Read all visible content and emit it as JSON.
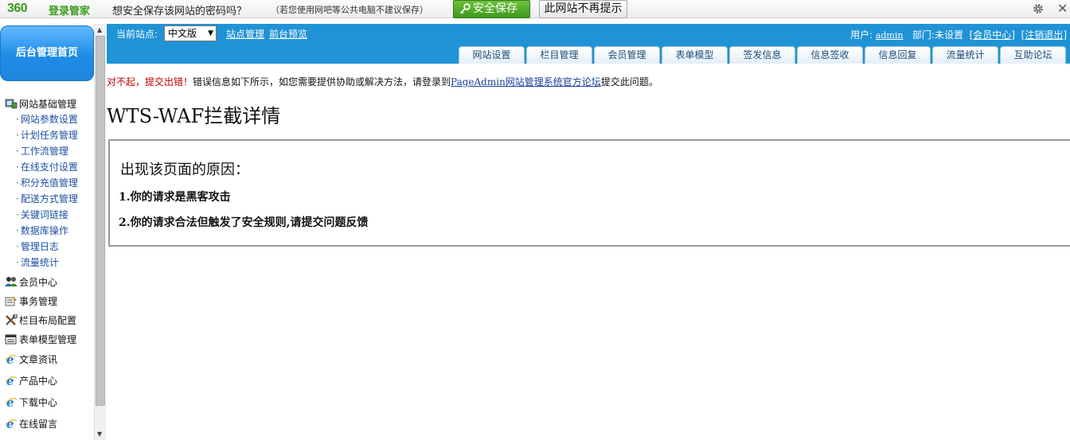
{
  "pwbar": {
    "logo_num": "360",
    "logo_text": "登录管家",
    "question": "想安全保存该网站的密码吗？",
    "hint": "（若您使用网吧等公共电脑不建议保存）",
    "save_label": "安全保存",
    "nohint_label": "此网站不再提示",
    "close_glyph": "✕"
  },
  "sidebar": {
    "home": "后台管理首页",
    "groups": [
      {
        "label": "网站基础管理",
        "icon": "settings-icon"
      },
      {
        "label": "会员中心",
        "icon": "members-icon"
      },
      {
        "label": "事务管理",
        "icon": "tasks-icon"
      },
      {
        "label": "栏目布局配置",
        "icon": "tools-icon"
      },
      {
        "label": "表单模型管理",
        "icon": "form-icon"
      },
      {
        "label": "文章资讯",
        "icon": "ie-icon"
      },
      {
        "label": "产品中心",
        "icon": "ie-icon"
      },
      {
        "label": "下载中心",
        "icon": "ie-icon"
      },
      {
        "label": "在线留言",
        "icon": "ie-icon"
      }
    ],
    "subitems": [
      "网站参数设置",
      "计划任务管理",
      "工作流管理",
      "在线支付设置",
      "积分充值管理",
      "配送方式管理",
      "关键词链接",
      "数据库操作",
      "管理日志",
      "流量统计"
    ]
  },
  "topbar": {
    "site_label": "当前站点:",
    "site_value": "中文版",
    "site_manage": "站点管理",
    "front_preview": "前台预览",
    "user_label": "用户:",
    "user_name": "admin",
    "dept_label": "部门:",
    "dept_value": "未设置",
    "member_center": "会员中心",
    "logout": "注销退出",
    "tabs": [
      "网站设置",
      "栏目管理",
      "会员管理",
      "表单模型",
      "签发信息",
      "信息签收",
      "信息回复",
      "流量统计",
      "互助论坛"
    ]
  },
  "main": {
    "err_red": "对不起，提交出错！",
    "err_text": "错误信息如下所示，如您需要提供协助或解决方法，请登录到",
    "err_link": "PageAdmin网站管理系统官方论坛",
    "err_tail": "提交此问题。",
    "waf_title": "WTS-WAF拦截详情",
    "reason_head": "出现该页面的原因：",
    "reason_1": "1.你的请求是黑客攻击",
    "reason_2": "2.你的请求合法但触发了安全规则,请提交问题反馈"
  }
}
